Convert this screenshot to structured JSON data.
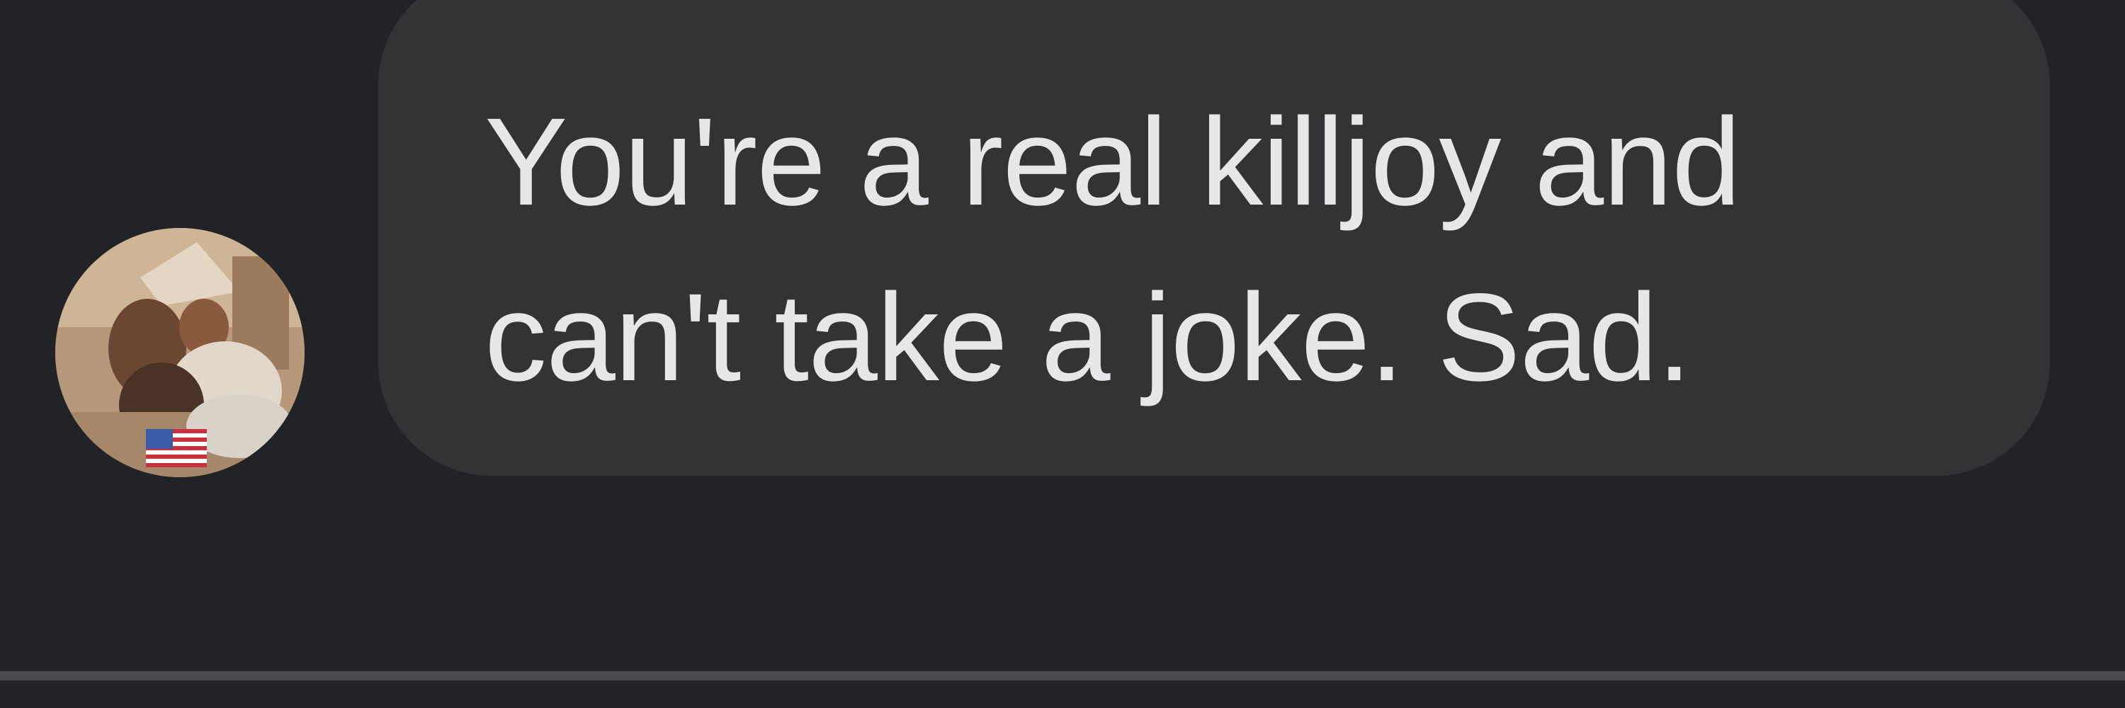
{
  "conversation": {
    "messages": [
      {
        "text": "You're a real killjoy and can't take a joke. Sad.",
        "avatar_icon": "user-photo-avatar-with-us-flag"
      }
    ]
  },
  "colors": {
    "background": "#222326",
    "bubble": "#333335",
    "text": "#e7e7ea",
    "divider": "#4a4b4f"
  }
}
